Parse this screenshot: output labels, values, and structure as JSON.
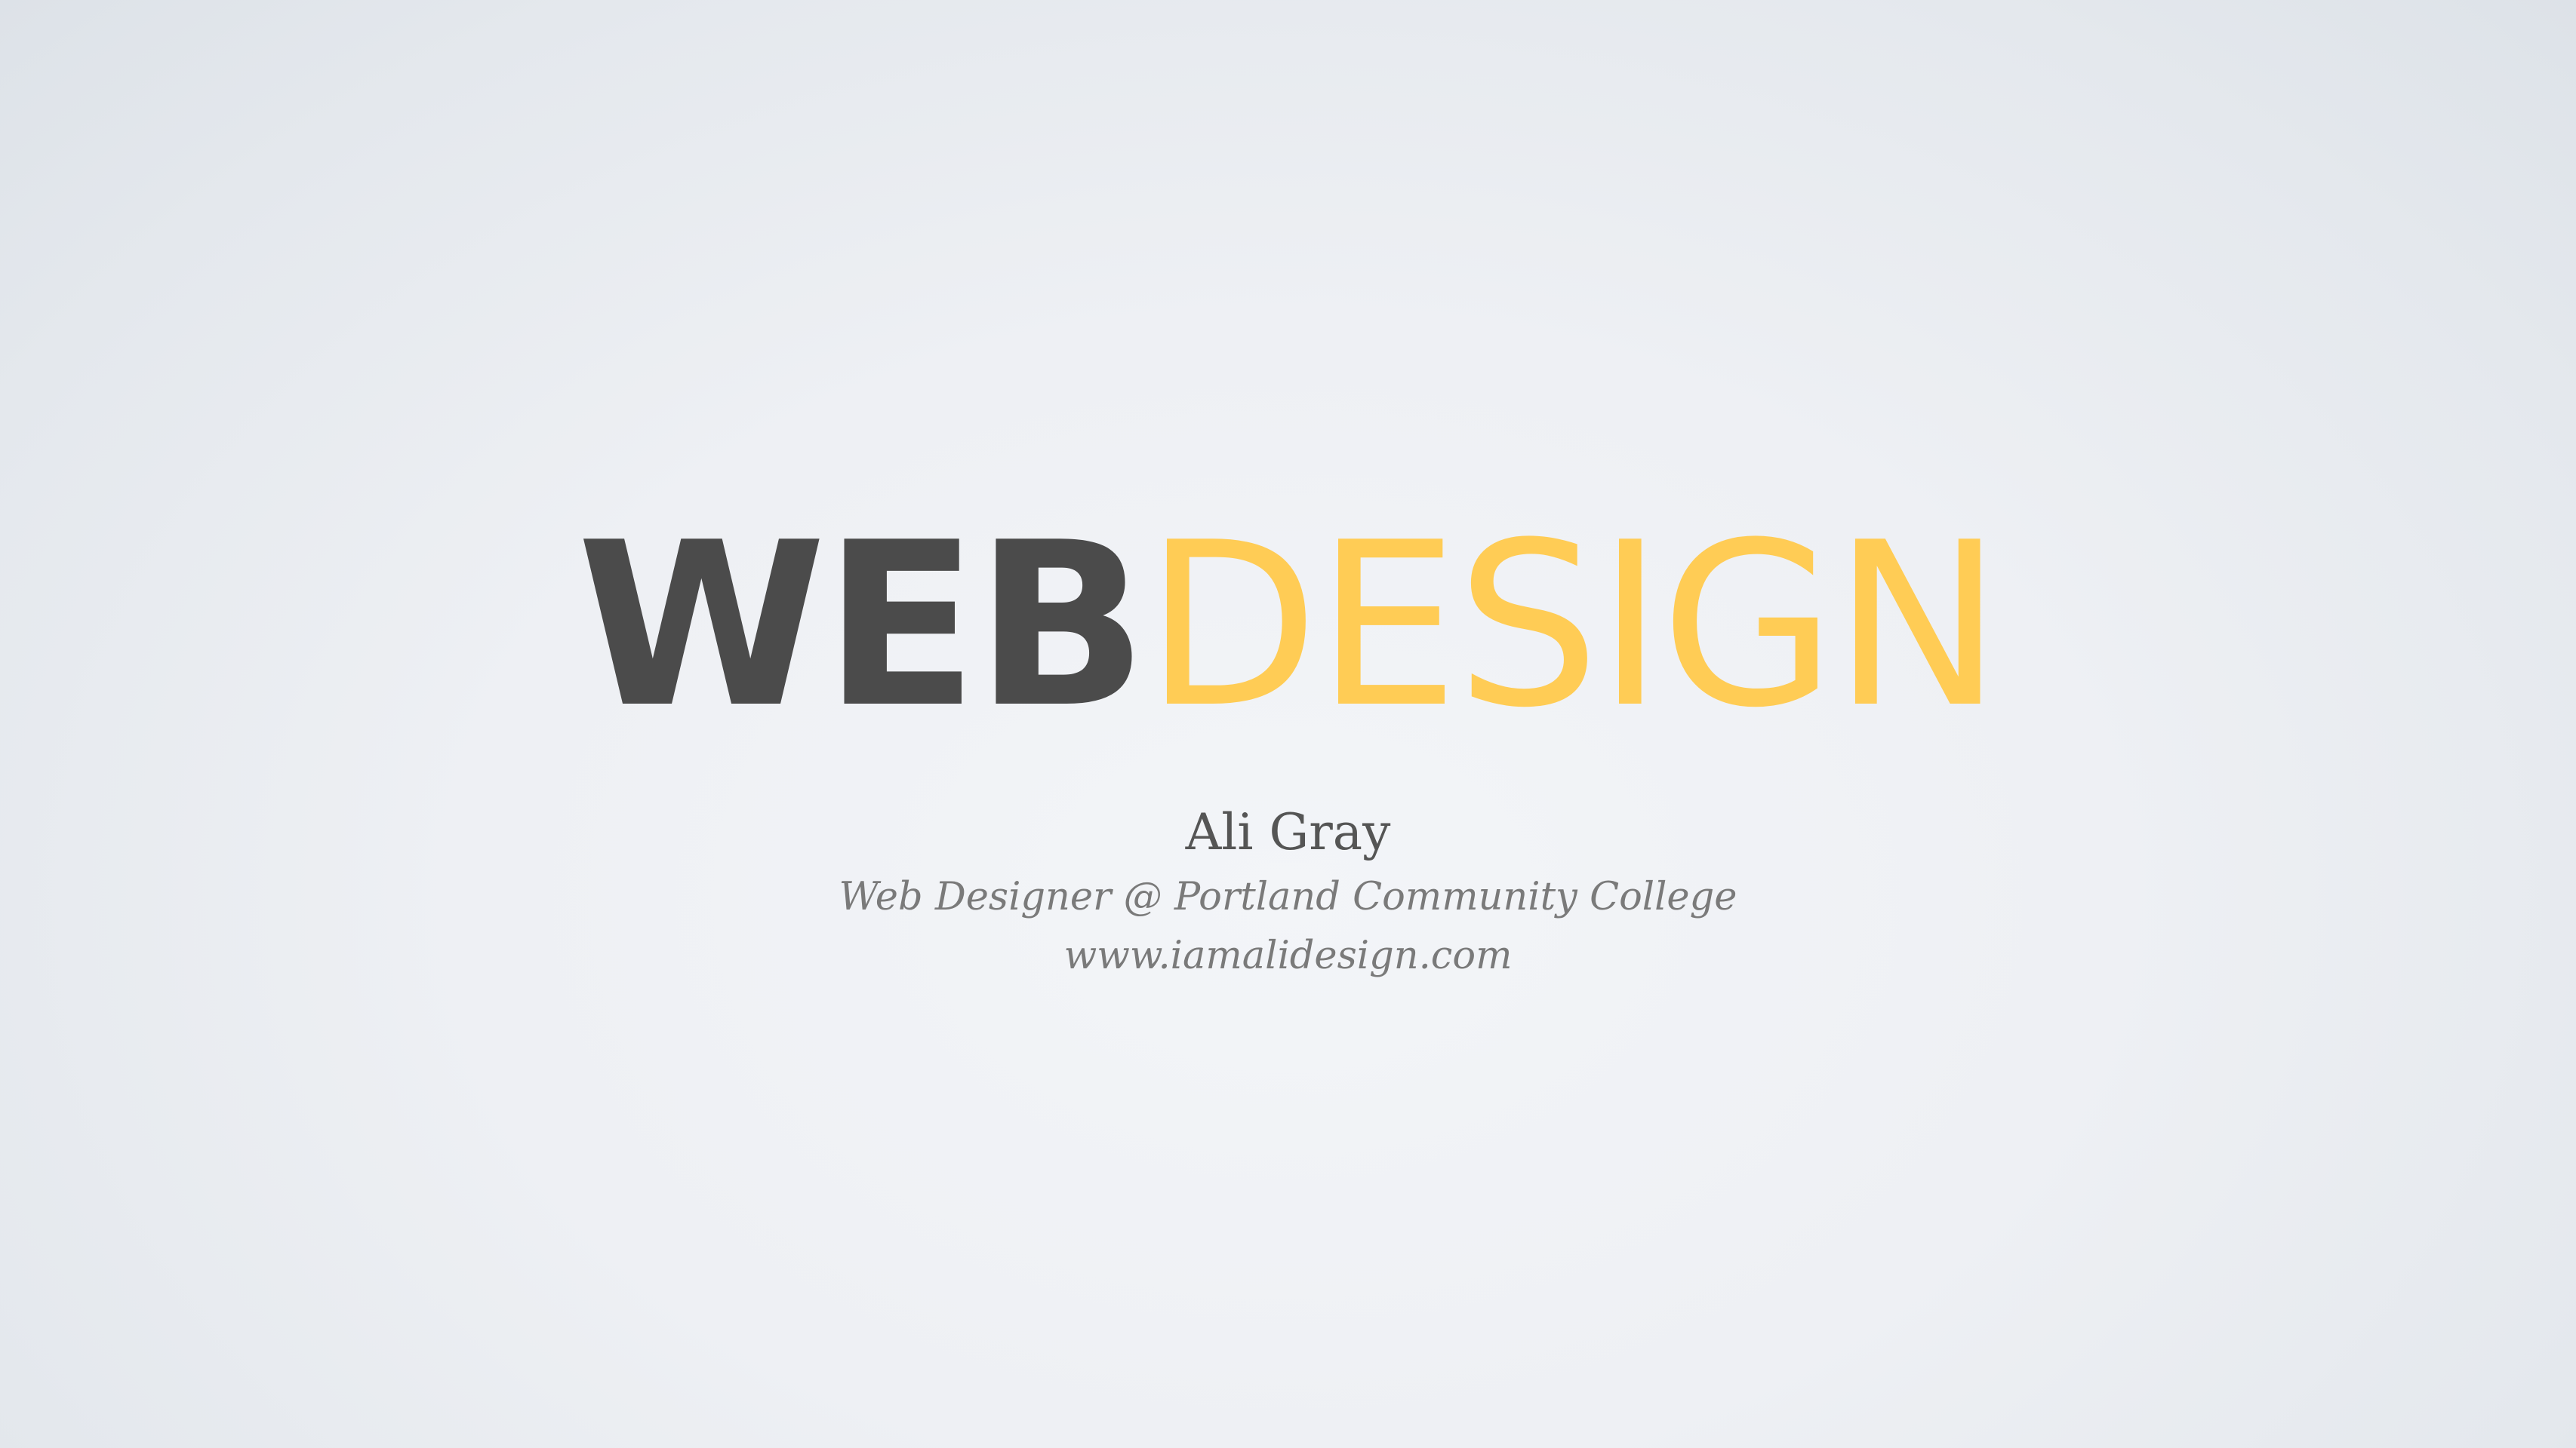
{
  "slide": {
    "title_part1": "WEB",
    "title_part2": "DESIGN",
    "author": "Ali Gray",
    "role": "Web Designer @ Portland Community College",
    "website": "www.iamalidesign.com"
  },
  "colors": {
    "title_part1": "#4b4b4b",
    "title_part2": "#ffcc55",
    "author": "#555555",
    "subtitle": "#7a7a7a",
    "background": "#eef0f4"
  }
}
